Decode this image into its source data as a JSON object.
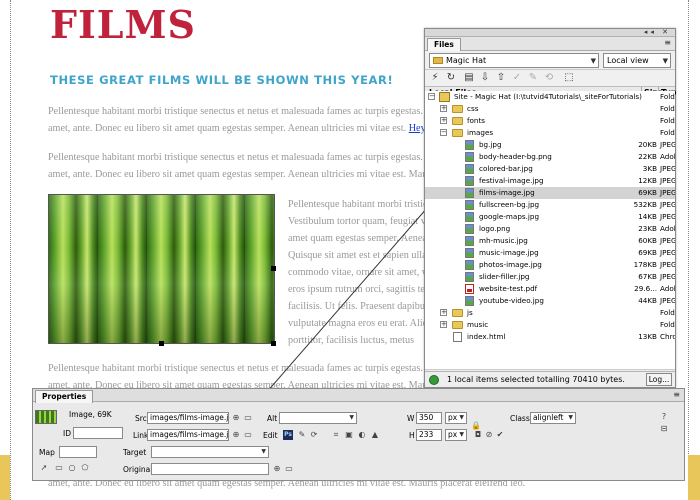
{
  "page": {
    "title": "FILMS",
    "subtitle": "THESE GREAT FILMS WILL BE SHOWN THIS YEAR!",
    "para1_line1": "Pellentesque habitant morbi tristique senectus et netus et malesuada fames ac turpis egestas. Vestibulum tortor quam, feugiat vitae, ultricies eget, tempor",
    "para1_line2": "amet, ante. Donec eu libero sit amet quam egestas semper. Aenean ultricies mi vitae est.",
    "para1_link": "Hey! Se",
    "para2_line1": "Pellentesque habitant morbi tristique senectus et netus et malesuada fames ac turpis egestas. Vestibulum tortor quam, feugiat vitae, ultricies eget, tempor",
    "para2_line2": "amet, ante. Donec eu libero sit amet quam egestas semper. Aenean ultricies mi vitae est. Mauris p",
    "wrap_lines": [
      "Pellentesque habitant morbi tristique",
      "Vestibulum tortor quam, feugiat vita",
      "amet quam egestas semper. Aenean",
      "Quisque sit amet est et sapien ullam",
      "commodo vitae, ornare sit amet, wi",
      "eros ipsum rutrum orci, sagittis tem",
      "facilisis. Ut felis. Praesent dapibus,",
      "vulputate magna eros eu erat. Aliqu",
      "porttitor, facilisis luctus, metus"
    ],
    "para4_line1": "Pellentesque habitant morbi tristique senectus et netus et malesuada fames ac turpis egestas. Vestibulum tortor quam, feugiat vitae, ultricies eget, tempor",
    "para4_line2": "amet, ante. Donec eu libero sit amet quam egestas semper. Aenean ultricies mi vitae est. Mauris",
    "bottom_line": "amet, ante. Donec eu libero sit amet quam egestas semper. Aenean ultricies mi vitae est. Mauris placerat eleifend leo."
  },
  "files_panel": {
    "tab": "Files",
    "site_select": "Magic Hat",
    "view_select": "Local view",
    "col_local": "Local Files",
    "col_size": "Size",
    "col_type": "Typ",
    "rows": [
      {
        "name": "Site - Magic Hat (I:\\tutvid4Tutorials\\_siteForTutorials)",
        "size": "",
        "type": "Fold"
      },
      {
        "name": "css",
        "size": "",
        "type": "Fold"
      },
      {
        "name": "fonts",
        "size": "",
        "type": "Fold"
      },
      {
        "name": "images",
        "size": "",
        "type": "Fold"
      },
      {
        "name": "bg.jpg",
        "size": "20KB",
        "type": "JPEG"
      },
      {
        "name": "body-header-bg.png",
        "size": "22KB",
        "type": "Adob"
      },
      {
        "name": "colored-bar.jpg",
        "size": "3KB",
        "type": "JPEG"
      },
      {
        "name": "festival-image.jpg",
        "size": "12KB",
        "type": "JPEG"
      },
      {
        "name": "films-image.jpg",
        "size": "69KB",
        "type": "JPEG"
      },
      {
        "name": "fullscreen-bg.jpg",
        "size": "532KB",
        "type": "JPEG"
      },
      {
        "name": "google-maps.jpg",
        "size": "14KB",
        "type": "JPEG"
      },
      {
        "name": "logo.png",
        "size": "23KB",
        "type": "Adob"
      },
      {
        "name": "mh-music.jpg",
        "size": "60KB",
        "type": "JPEG"
      },
      {
        "name": "music-image.jpg",
        "size": "69KB",
        "type": "JPEG"
      },
      {
        "name": "photos-image.jpg",
        "size": "178KB",
        "type": "JPEG"
      },
      {
        "name": "slider-filler.jpg",
        "size": "67KB",
        "type": "JPEG"
      },
      {
        "name": "website-test.pdf",
        "size": "29.6...",
        "type": "Adob"
      },
      {
        "name": "youtube-video.jpg",
        "size": "44KB",
        "type": "JPEG"
      },
      {
        "name": "js",
        "size": "",
        "type": "Fold"
      },
      {
        "name": "music",
        "size": "",
        "type": "Fold"
      },
      {
        "name": "index.html",
        "size": "13KB",
        "type": "Chro"
      }
    ],
    "status": "1 local items selected totalling 70410 bytes.",
    "log_button": "Log..."
  },
  "properties": {
    "tab": "Properties",
    "image_info": "Image, 69K",
    "id_label": "ID",
    "src_label": "Src",
    "src_value": "images/films-image.jpg",
    "link_label": "Link",
    "link_value": "images/films-image.jpg",
    "alt_label": "Alt",
    "alt_value": "",
    "edit_label": "Edit",
    "w_label": "W",
    "w_value": "350",
    "w_unit": "px",
    "h_label": "H",
    "h_value": "233",
    "h_unit": "px",
    "class_label": "Class",
    "class_value": "alignleft",
    "map_label": "Map",
    "target_label": "Target",
    "original_label": "Original",
    "ps_badge": "Ps"
  }
}
